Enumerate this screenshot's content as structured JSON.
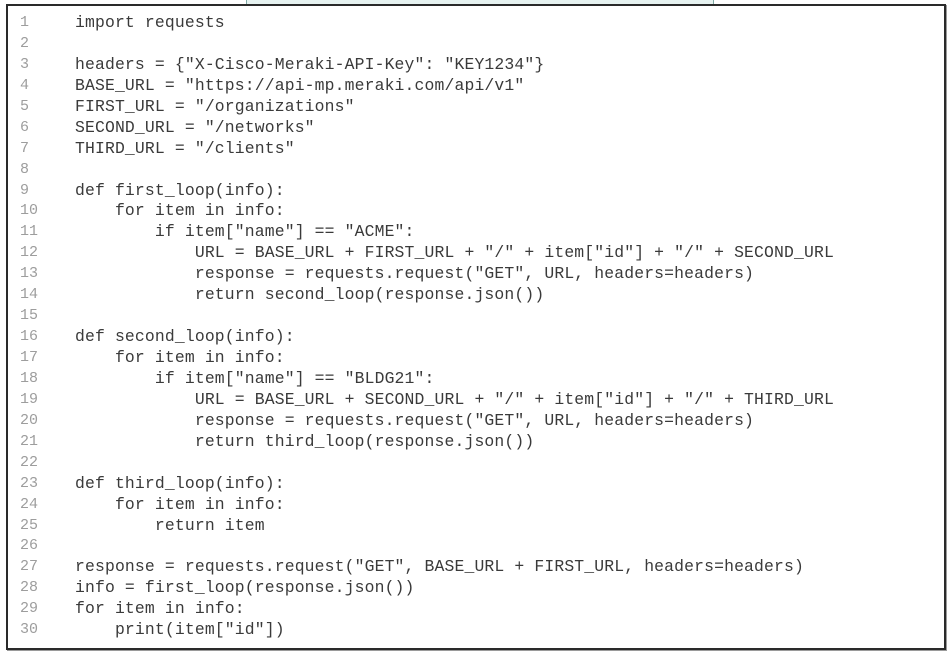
{
  "document": {
    "language": "python",
    "lines": [
      {
        "num": "1",
        "code": "import requests"
      },
      {
        "num": "2",
        "code": ""
      },
      {
        "num": "3",
        "code": "headers = {\"X-Cisco-Meraki-API-Key\": \"KEY1234\"}"
      },
      {
        "num": "4",
        "code": "BASE_URL = \"https://api-mp.meraki.com/api/v1\""
      },
      {
        "num": "5",
        "code": "FIRST_URL = \"/organizations\""
      },
      {
        "num": "6",
        "code": "SECOND_URL = \"/networks\""
      },
      {
        "num": "7",
        "code": "THIRD_URL = \"/clients\""
      },
      {
        "num": "8",
        "code": ""
      },
      {
        "num": "9",
        "code": "def first_loop(info):"
      },
      {
        "num": "10",
        "code": "    for item in info:"
      },
      {
        "num": "11",
        "code": "        if item[\"name\"] == \"ACME\":"
      },
      {
        "num": "12",
        "code": "            URL = BASE_URL + FIRST_URL + \"/\" + item[\"id\"] + \"/\" + SECOND_URL"
      },
      {
        "num": "13",
        "code": "            response = requests.request(\"GET\", URL, headers=headers)"
      },
      {
        "num": "14",
        "code": "            return second_loop(response.json())"
      },
      {
        "num": "15",
        "code": ""
      },
      {
        "num": "16",
        "code": "def second_loop(info):"
      },
      {
        "num": "17",
        "code": "    for item in info:"
      },
      {
        "num": "18",
        "code": "        if item[\"name\"] == \"BLDG21\":"
      },
      {
        "num": "19",
        "code": "            URL = BASE_URL + SECOND_URL + \"/\" + item[\"id\"] + \"/\" + THIRD_URL"
      },
      {
        "num": "20",
        "code": "            response = requests.request(\"GET\", URL, headers=headers)"
      },
      {
        "num": "21",
        "code": "            return third_loop(response.json())"
      },
      {
        "num": "22",
        "code": ""
      },
      {
        "num": "23",
        "code": "def third_loop(info):"
      },
      {
        "num": "24",
        "code": "    for item in info:"
      },
      {
        "num": "25",
        "code": "        return item"
      },
      {
        "num": "26",
        "code": ""
      },
      {
        "num": "27",
        "code": "response = requests.request(\"GET\", BASE_URL + FIRST_URL, headers=headers)"
      },
      {
        "num": "28",
        "code": "info = first_loop(response.json())"
      },
      {
        "num": "29",
        "code": "for item in info:"
      },
      {
        "num": "30",
        "code": "    print(item[\"id\"])"
      }
    ]
  },
  "colors": {
    "code_text": "#3a3a3a",
    "line_number": "#9d9d9d",
    "frame_border": "#2a2a2a",
    "background": "#ffffff",
    "top_strip": "#e6f2f0"
  }
}
